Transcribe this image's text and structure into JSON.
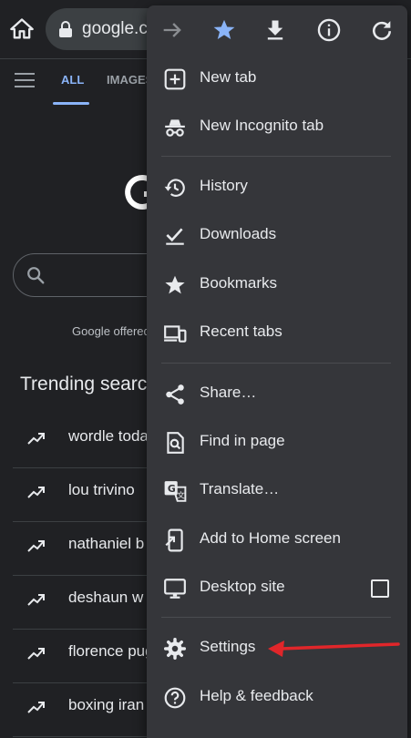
{
  "browser": {
    "url_text": "google.com"
  },
  "google_page": {
    "tab_all": "ALL",
    "tab_images": "IMAGES",
    "offered_text": "Google offered in",
    "trending_title": "Trending searches",
    "trending": [
      "wordle today",
      "lou trivino",
      "nathaniel b",
      "deshaun w",
      "florence pugh",
      "boxing iran"
    ]
  },
  "menu": {
    "toolbar_icons": [
      "forward-icon",
      "star-icon",
      "download-icon",
      "info-icon",
      "refresh-icon"
    ],
    "items": {
      "new_tab": "New tab",
      "new_incognito_tab": "New Incognito tab",
      "history": "History",
      "downloads": "Downloads",
      "bookmarks": "Bookmarks",
      "recent_tabs": "Recent tabs",
      "share": "Share…",
      "find_in_page": "Find in page",
      "translate": "Translate…",
      "add_to_home": "Add to Home screen",
      "desktop_site": "Desktop site",
      "settings": "Settings",
      "help_feedback": "Help & feedback"
    },
    "desktop_site_checked": false
  },
  "colors": {
    "background": "#202124",
    "menu_background": "#35363a",
    "accent_blue": "#8ab4f8",
    "annotation_arrow": "#e0262a"
  }
}
